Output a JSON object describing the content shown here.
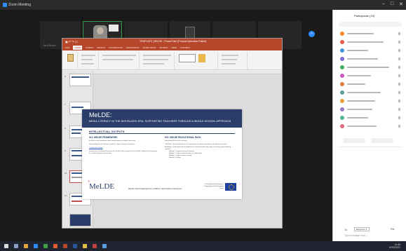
{
  "window": {
    "title": "Zoom Meeting",
    "controls": [
      "–",
      "□",
      "✕"
    ]
  },
  "gallery": {
    "participants": [
      {
        "name": "Yana Bonev"
      },
      {
        "name": ""
      },
      {
        "name": "Marielle - Szymo..."
      },
      {
        "name": ""
      },
      {
        "name": "epsgmnuprodas"
      },
      {
        "name": "e-Biokendikah.dr..."
      }
    ],
    "next_label": "›"
  },
  "powerpoint": {
    "title": "TEMPLATE_MELDE - PowerPoint (Product Activation Failed)",
    "quick_access": "▣ ↶ ↷ ☐",
    "tabs": [
      "FILE",
      "HOME",
      "INSERT",
      "DESIGN",
      "TRANSITIONS",
      "ANIMATIONS",
      "SLIDE SHOW",
      "REVIEW",
      "VIEW",
      "ACROBAT"
    ],
    "selected_tab": "HOME",
    "thumbnail_numbers": [
      "6",
      "7",
      "8",
      "9",
      "10",
      "11"
    ],
    "slide": {
      "title": "MeLDE:",
      "subtitle": "MEDIA LITERACY IN THE DIGITALIZED ERA: SUPPORTING TEACHERS THROUGH A WHOLE-SCHOOL APPROACH",
      "section": "INTELLECTUAL OUTPUTS",
      "left": {
        "heading": "IO1: MELDE FRAMEWORK",
        "intro": "A whole-school framework about media literacy for digital citizenship.",
        "bullets": [
          "National Reports of 5 partner countries: Cyprus, Greece, Germany",
          "Comparative Report",
          "Competence Framework based on the results of the research on the Digital Competence Framework 2.1 of the European Commission"
        ]
      },
      "right": {
        "heading": "IO2: MELDE EDUCATIONAL PACK",
        "intro": "Educational Pack which contains:",
        "bullets": [
          "Tool Book: Learning Resources for exploring & teaching media literacy for digital citizenship",
          "Academy: On-line provision of modules as a start for digital citizenship, consisting of the following modules:",
          "Module 1: Digital teaching & learning",
          "Module 2: Online communication & collaboration",
          "Module 3: Digital content creation",
          "Module 4: Safety"
        ]
      },
      "logo": "MeLDE",
      "footer": "Website: https://meldeproject.eu/ | e-Platform: https://melde.eu-learning.eu/",
      "eu_text": "Co-funded by the Erasmus+ Programme of the European Union"
    }
  },
  "panel": {
    "title": "Participants (19)",
    "participant_count": 19,
    "buttons": [
      "Invite",
      "Mute All"
    ],
    "chat": {
      "to_label": "To:",
      "recipient": "Everyone ▾",
      "file_label": "File",
      "placeholder": "Type message here..."
    }
  },
  "taskbar": {
    "time": "11:40",
    "date": "8/12/2021"
  },
  "colors": {
    "slide_header": "#2b3e6a",
    "ppt_brand": "#b7472a",
    "zoom_blue": "#2d8cff",
    "active_speaker": "#2f9e44",
    "eu_blue": "#1d3fa0"
  }
}
